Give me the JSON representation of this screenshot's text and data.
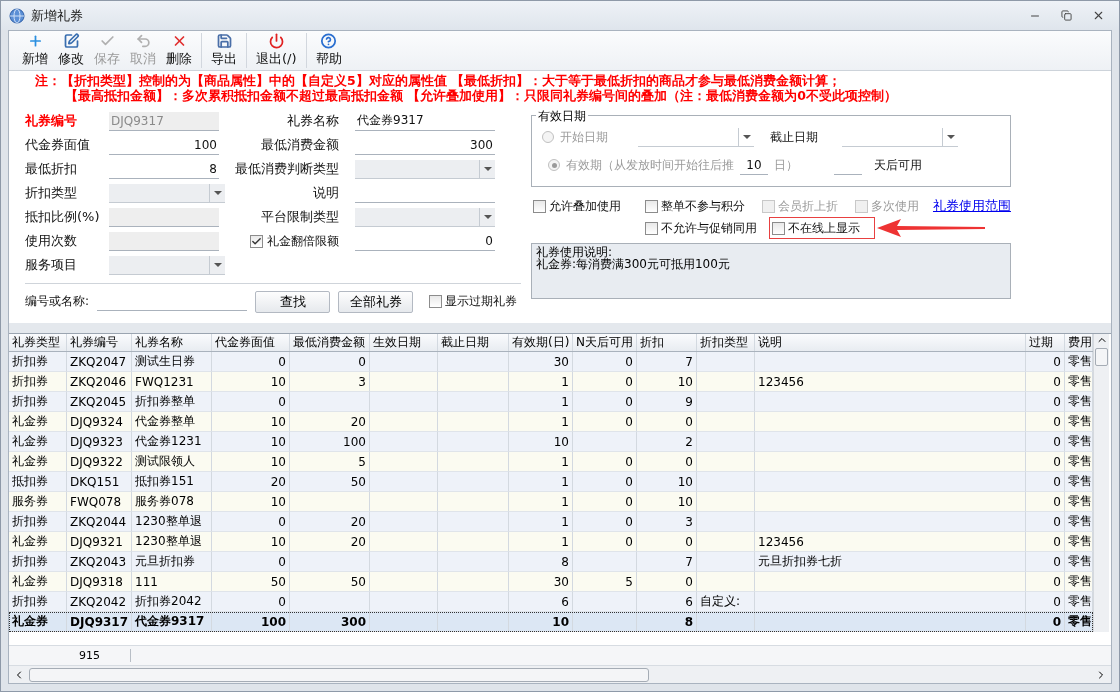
{
  "window": {
    "title": "新增礼券"
  },
  "toolbar": [
    [
      {
        "label": "新增",
        "kind": "add",
        "disabled": false
      },
      {
        "label": "修改",
        "kind": "edit",
        "disabled": false
      },
      {
        "label": "保存",
        "kind": "save",
        "disabled": true
      },
      {
        "label": "取消",
        "kind": "cancel",
        "disabled": true
      },
      {
        "label": "删除",
        "kind": "delete",
        "disabled": false
      }
    ],
    [
      {
        "label": "导出",
        "kind": "export",
        "disabled": false
      }
    ],
    [
      {
        "label": "退出(/)",
        "kind": "exit",
        "disabled": false
      }
    ],
    [
      {
        "label": "帮助",
        "kind": "help",
        "disabled": false
      }
    ]
  ],
  "notes": [
    "注：【折扣类型】控制的为【商品属性】中的【自定义5】对应的属性值 【最低折扣】：大于等于最低折扣的商品才参与最低消费金额计算；",
    "【最高抵扣金额】：多次累积抵扣金额不超过最高抵扣金额 【允许叠加使用】：只限同礼券编号间的叠加（注：最低消费金额为0不受此项控制）"
  ],
  "form": {
    "left": [
      {
        "label": "礼券编号",
        "kind": "disabled",
        "value": "DJQ9317",
        "required": true
      },
      {
        "label": "代金券面值",
        "kind": "number",
        "value": "100",
        "required": false
      },
      {
        "label": "最低折扣",
        "kind": "number",
        "value": "8",
        "required": false
      },
      {
        "label": "折扣类型",
        "kind": "combo",
        "required": false
      },
      {
        "label": "抵扣比例(%)",
        "kind": "disabled",
        "required": false
      },
      {
        "label": "使用次数",
        "kind": "disabled",
        "required": false
      },
      {
        "label": "服务项目",
        "kind": "combo",
        "required": false
      }
    ],
    "right": [
      {
        "label": "礼券名称",
        "kind": "text",
        "value": "代金券9317",
        "required": false
      },
      {
        "label": "最低消费金额",
        "kind": "number",
        "value": "300",
        "required": false
      },
      {
        "label": "最低消费判断类型",
        "kind": "combo",
        "required": false
      },
      {
        "label": "说明",
        "kind": "text",
        "required": false
      },
      {
        "label": "平台限制类型",
        "kind": "combo",
        "required": false
      },
      {
        "label": "礼金翻倍限额",
        "kind": "checkfield",
        "checked": true,
        "value": "0",
        "required": false
      }
    ]
  },
  "search": {
    "label": "编号或名称:",
    "buttons": [
      "查找",
      "全部礼券"
    ],
    "show_expired": {
      "label": "显示过期礼券",
      "checked": false
    }
  },
  "validity": {
    "title": "有效日期",
    "disabled": true,
    "start": {
      "label": "开始日期",
      "selected": false
    },
    "end_label": "截止日期",
    "period": {
      "label": "有效期（从发放时间开始往后推",
      "value": "10",
      "unit": "日）",
      "selected": true
    },
    "delay_unit": "天后可用"
  },
  "options": {
    "row1": [
      {
        "label": "允许叠加使用",
        "checked": false,
        "disabled": false,
        "highlighted": false
      },
      {
        "label": "整单不参与积分",
        "checked": false,
        "disabled": false,
        "highlighted": false
      },
      {
        "label": "会员折上折",
        "checked": false,
        "disabled": true,
        "highlighted": false
      },
      {
        "label": "多次使用",
        "checked": false,
        "disabled": true,
        "highlighted": false
      }
    ],
    "link": "礼券使用范围",
    "row2": [
      {
        "label": "不允许与促销同用",
        "checked": false,
        "disabled": false,
        "highlighted": false
      },
      {
        "label": "不在线上显示",
        "checked": false,
        "disabled": false,
        "highlighted": true
      }
    ]
  },
  "description": {
    "lines": [
      "礼券使用说明:",
      "礼金券:每消费满300元可抵用100元"
    ]
  },
  "table": {
    "columns": [
      "礼券类型",
      "礼券编号",
      "礼券名称",
      "代金券面值",
      "最低消费金额",
      "生效日期",
      "截止日期",
      "有效期(日)",
      "N天后可用",
      "折扣",
      "折扣类型",
      "说明",
      "过期",
      "费用"
    ],
    "rows": [
      {
        "selected": false,
        "cells": [
          "折扣券",
          "ZKQ2047",
          "测试生日券",
          "0",
          "0",
          null,
          null,
          "30",
          "0",
          "7",
          null,
          null,
          "0",
          "零售"
        ]
      },
      {
        "selected": false,
        "cells": [
          "折扣券",
          "ZKQ2046",
          "FWQ1231",
          "10",
          "3",
          null,
          null,
          "1",
          "0",
          "10",
          null,
          "123456",
          "0",
          "零售"
        ]
      },
      {
        "selected": false,
        "cells": [
          "折扣券",
          "ZKQ2045",
          "折扣券整单",
          "0",
          null,
          null,
          null,
          "1",
          "0",
          "9",
          null,
          null,
          "0",
          "零售"
        ]
      },
      {
        "selected": false,
        "cells": [
          "礼金券",
          "DJQ9324",
          "代金券整单",
          "10",
          "20",
          null,
          null,
          "1",
          "0",
          "0",
          null,
          null,
          "0",
          "零售"
        ]
      },
      {
        "selected": false,
        "cells": [
          "礼金券",
          "DJQ9323",
          "代金券1231",
          "10",
          "100",
          null,
          null,
          "10",
          null,
          "2",
          null,
          null,
          "0",
          "零售"
        ]
      },
      {
        "selected": false,
        "cells": [
          "礼金券",
          "DJQ9322",
          "测试限领人",
          "10",
          "5",
          null,
          null,
          "1",
          "0",
          "0",
          null,
          null,
          "0",
          "零售"
        ]
      },
      {
        "selected": false,
        "cells": [
          "抵扣券",
          "DKQ151",
          "抵扣券151",
          "20",
          "50",
          null,
          null,
          "1",
          "0",
          "10",
          null,
          null,
          "0",
          "零售"
        ]
      },
      {
        "selected": false,
        "cells": [
          "服务券",
          "FWQ078",
          "服务券078",
          "10",
          null,
          null,
          null,
          "1",
          "0",
          "10",
          null,
          null,
          "0",
          "零售"
        ]
      },
      {
        "selected": false,
        "cells": [
          "折扣券",
          "ZKQ2044",
          "1230整单退",
          "0",
          "20",
          null,
          null,
          "1",
          "0",
          "3",
          null,
          null,
          "0",
          "零售"
        ]
      },
      {
        "selected": false,
        "cells": [
          "礼金券",
          "DJQ9321",
          "1230整单退",
          "10",
          "20",
          null,
          null,
          "1",
          "0",
          "0",
          null,
          "123456",
          "0",
          "零售"
        ]
      },
      {
        "selected": false,
        "cells": [
          "折扣券",
          "ZKQ2043",
          "元旦折扣券",
          "0",
          null,
          null,
          null,
          "8",
          null,
          "7",
          null,
          "元旦折扣券七折",
          "0",
          "零售"
        ]
      },
      {
        "selected": false,
        "cells": [
          "礼金券",
          "DJQ9318",
          "111",
          "50",
          "50",
          null,
          null,
          "30",
          "5",
          "0",
          null,
          null,
          "0",
          "零售"
        ]
      },
      {
        "selected": false,
        "cells": [
          "折扣券",
          "ZKQ2042",
          "折扣券2042",
          "0",
          null,
          null,
          null,
          "6",
          null,
          "6",
          "自定义:",
          null,
          "0",
          "零售"
        ]
      },
      {
        "selected": true,
        "cells": [
          "礼金券",
          "DJQ9317",
          "代金券9317",
          "100",
          "300",
          null,
          null,
          "10",
          null,
          "8",
          null,
          null,
          "0",
          "零售"
        ]
      }
    ]
  },
  "footer": {
    "count": "915"
  }
}
